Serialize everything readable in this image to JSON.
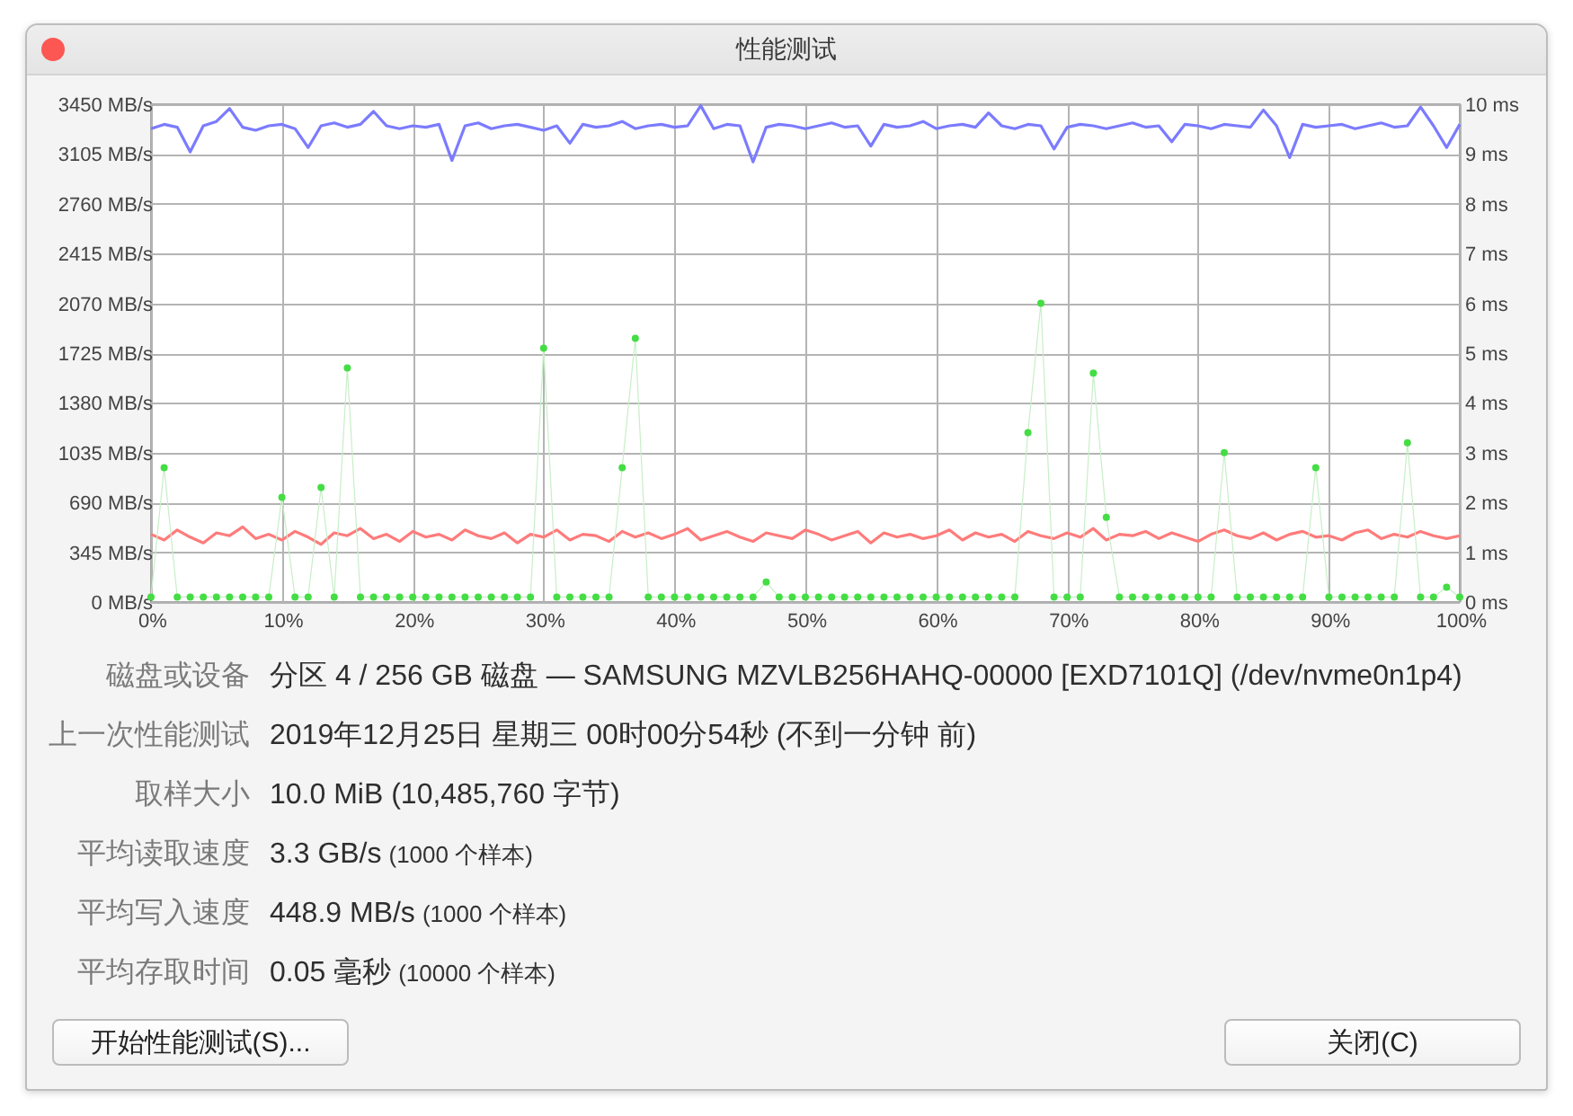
{
  "window": {
    "title": "性能测试"
  },
  "performance_chart": {
    "chart_data": {
      "type": "line",
      "grid": true,
      "xlim": [
        0,
        100
      ],
      "ylim": [
        0,
        3450
      ],
      "y2lim": [
        0,
        10
      ],
      "x": [
        0,
        1,
        2,
        3,
        4,
        5,
        6,
        7,
        8,
        9,
        10,
        11,
        12,
        13,
        14,
        15,
        16,
        17,
        18,
        19,
        20,
        21,
        22,
        23,
        24,
        25,
        26,
        27,
        28,
        29,
        30,
        31,
        32,
        33,
        34,
        35,
        36,
        37,
        38,
        39,
        40,
        41,
        42,
        43,
        44,
        45,
        46,
        47,
        48,
        49,
        50,
        51,
        52,
        53,
        54,
        55,
        56,
        57,
        58,
        59,
        60,
        61,
        62,
        63,
        64,
        65,
        66,
        67,
        68,
        69,
        70,
        71,
        72,
        73,
        74,
        75,
        76,
        77,
        78,
        79,
        80,
        81,
        82,
        83,
        84,
        85,
        86,
        87,
        88,
        89,
        90,
        91,
        92,
        93,
        94,
        95,
        96,
        97,
        98,
        99,
        100
      ],
      "xticks": [
        {
          "value": 0,
          "label": "0%"
        },
        {
          "value": 10,
          "label": "10%"
        },
        {
          "value": 20,
          "label": "20%"
        },
        {
          "value": 30,
          "label": "30%"
        },
        {
          "value": 40,
          "label": "40%"
        },
        {
          "value": 50,
          "label": "50%"
        },
        {
          "value": 60,
          "label": "60%"
        },
        {
          "value": 70,
          "label": "70%"
        },
        {
          "value": 80,
          "label": "80%"
        },
        {
          "value": 90,
          "label": "90%"
        },
        {
          "value": 100,
          "label": "100%"
        }
      ],
      "yticks": [
        {
          "value": 0,
          "label": "0 MB/s"
        },
        {
          "value": 345,
          "label": "345 MB/s"
        },
        {
          "value": 690,
          "label": "690 MB/s"
        },
        {
          "value": 1035,
          "label": "1035 MB/s"
        },
        {
          "value": 1380,
          "label": "1380 MB/s"
        },
        {
          "value": 1725,
          "label": "1725 MB/s"
        },
        {
          "value": 2070,
          "label": "2070 MB/s"
        },
        {
          "value": 2415,
          "label": "2415 MB/s"
        },
        {
          "value": 2760,
          "label": "2760 MB/s"
        },
        {
          "value": 3105,
          "label": "3105 MB/s"
        },
        {
          "value": 3450,
          "label": "3450 MB/s"
        }
      ],
      "y2ticks": [
        {
          "value": 0,
          "label": "0 ms"
        },
        {
          "value": 1,
          "label": "1 ms"
        },
        {
          "value": 2,
          "label": "2 ms"
        },
        {
          "value": 3,
          "label": "3 ms"
        },
        {
          "value": 4,
          "label": "4 ms"
        },
        {
          "value": 5,
          "label": "5 ms"
        },
        {
          "value": 6,
          "label": "6 ms"
        },
        {
          "value": 7,
          "label": "7 ms"
        },
        {
          "value": 8,
          "label": "8 ms"
        },
        {
          "value": 9,
          "label": "9 ms"
        },
        {
          "value": 10,
          "label": "10 ms"
        }
      ],
      "series": [
        {
          "color": "#7b7bff",
          "values": [
            3280,
            3310,
            3290,
            3120,
            3300,
            3330,
            3420,
            3290,
            3270,
            3300,
            3310,
            3280,
            3150,
            3300,
            3320,
            3290,
            3310,
            3400,
            3300,
            3280,
            3300,
            3290,
            3310,
            3060,
            3300,
            3320,
            3280,
            3300,
            3310,
            3290,
            3270,
            3300,
            3180,
            3310,
            3290,
            3300,
            3330,
            3280,
            3300,
            3310,
            3290,
            3300,
            3440,
            3280,
            3310,
            3300,
            3050,
            3290,
            3310,
            3300,
            3280,
            3300,
            3320,
            3290,
            3300,
            3160,
            3310,
            3290,
            3300,
            3330,
            3280,
            3300,
            3310,
            3290,
            3390,
            3300,
            3280,
            3310,
            3300,
            3140,
            3290,
            3310,
            3300,
            3280,
            3300,
            3320,
            3290,
            3300,
            3190,
            3310,
            3300,
            3280,
            3310,
            3300,
            3290,
            3410,
            3300,
            3080,
            3310,
            3290,
            3300,
            3310,
            3280,
            3300,
            3320,
            3290,
            3300,
            3430,
            3300,
            3150,
            3310
          ]
        },
        {
          "color": "#ff7b7b",
          "values": [
            470,
            430,
            500,
            450,
            410,
            480,
            460,
            520,
            440,
            470,
            430,
            490,
            450,
            400,
            480,
            460,
            510,
            440,
            470,
            420,
            490,
            450,
            470,
            430,
            500,
            460,
            440,
            480,
            410,
            470,
            450,
            500,
            430,
            470,
            460,
            420,
            490,
            450,
            480,
            440,
            470,
            510,
            430,
            460,
            490,
            450,
            420,
            480,
            460,
            440,
            500,
            470,
            430,
            460,
            490,
            410,
            480,
            450,
            470,
            440,
            460,
            500,
            430,
            480,
            450,
            470,
            420,
            490,
            460,
            440,
            480,
            450,
            510,
            430,
            470,
            460,
            490,
            440,
            480,
            450,
            420,
            470,
            500,
            460,
            440,
            480,
            430,
            470,
            490,
            450,
            460,
            430,
            480,
            500,
            440,
            470,
            450,
            490,
            460,
            440,
            460
          ]
        },
        {
          "axis": "y2",
          "marker": "circle",
          "color": "#44dd44",
          "values": [
            0.1,
            2.7,
            0.1,
            0.1,
            0.1,
            0.1,
            0.1,
            0.1,
            0.1,
            0.1,
            2.1,
            0.1,
            0.1,
            2.3,
            0.1,
            4.7,
            0.1,
            0.1,
            0.1,
            0.1,
            0.1,
            0.1,
            0.1,
            0.1,
            0.1,
            0.1,
            0.1,
            0.1,
            0.1,
            0.1,
            5.1,
            0.1,
            0.1,
            0.1,
            0.1,
            0.1,
            2.7,
            5.3,
            0.1,
            0.1,
            0.1,
            0.1,
            0.1,
            0.1,
            0.1,
            0.1,
            0.1,
            0.4,
            0.1,
            0.1,
            0.1,
            0.1,
            0.1,
            0.1,
            0.1,
            0.1,
            0.1,
            0.1,
            0.1,
            0.1,
            0.1,
            0.1,
            0.1,
            0.1,
            0.1,
            0.1,
            0.1,
            3.4,
            6.0,
            0.1,
            0.1,
            0.1,
            4.6,
            1.7,
            0.1,
            0.1,
            0.1,
            0.1,
            0.1,
            0.1,
            0.1,
            0.1,
            3.0,
            0.1,
            0.1,
            0.1,
            0.1,
            0.1,
            0.1,
            2.7,
            0.1,
            0.1,
            0.1,
            0.1,
            0.1,
            0.1,
            3.2,
            0.1,
            0.1,
            0.3,
            0.1
          ]
        }
      ]
    }
  },
  "details": [
    {
      "label": "磁盘或设备",
      "value": "分区 4 / 256 GB 磁盘 — SAMSUNG MZVLB256HAHQ-00000 [EXD7101Q] (/dev/nvme0n1p4)"
    },
    {
      "label": "上一次性能测试",
      "value": "2019年12月25日 星期三 00时00分54秒 (不到一分钟 前)"
    },
    {
      "label": "取样大小",
      "value": "10.0 MiB (10,485,760 字节)"
    },
    {
      "label": "平均读取速度",
      "value": "3.3 GB/s",
      "note": "(1000 个样本)"
    },
    {
      "label": "平均写入速度",
      "value": "448.9 MB/s",
      "note": "(1000 个样本)"
    },
    {
      "label": "平均存取时间",
      "value": "0.05 毫秒",
      "note": "(10000 个样本)"
    }
  ],
  "start_button": {
    "label": "开始性能测试(S)..."
  },
  "close_button": {
    "label": "关闭(C)"
  }
}
